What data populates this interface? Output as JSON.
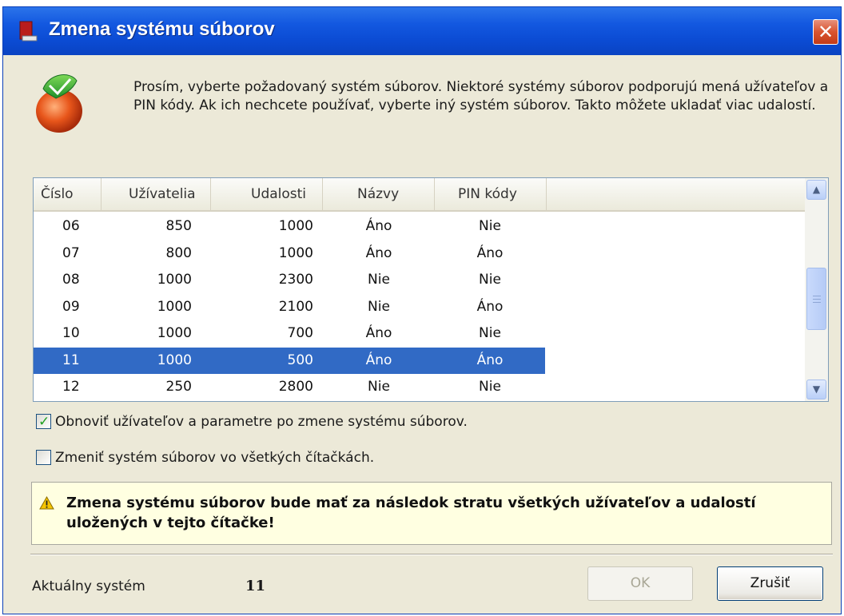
{
  "window": {
    "title": "Zmena systému súborov",
    "close_label": "✕"
  },
  "intro_text": "Prosím, vyberte požadovaný systém súborov. Niektoré systémy súborov podporujú mená užívateľov a PIN kódy. Ak ich nechcete používať, vyberte iný systém súborov. Takto môžete ukladať viac udalostí.",
  "table": {
    "columns": [
      "Číslo",
      "Užívatelia",
      "Udalosti",
      "Názvy",
      "PIN kódy"
    ],
    "rows": [
      [
        "06",
        "850",
        "1000",
        "Áno",
        "Nie"
      ],
      [
        "07",
        "800",
        "1000",
        "Áno",
        "Áno"
      ],
      [
        "08",
        "1000",
        "2300",
        "Nie",
        "Nie"
      ],
      [
        "09",
        "1000",
        "2100",
        "Nie",
        "Áno"
      ],
      [
        "10",
        "1000",
        "700",
        "Áno",
        "Nie"
      ],
      [
        "11",
        "1000",
        "500",
        "Áno",
        "Áno"
      ],
      [
        "12",
        "250",
        "2800",
        "Nie",
        "Nie"
      ]
    ],
    "selected_row_number": "11"
  },
  "options": {
    "restore_users": {
      "label": "Obnoviť užívateľov a parametre po zmene systému súborov.",
      "checked": true
    },
    "change_all_readers": {
      "label": "Zmeniť systém súborov vo všetkých čítačkách.",
      "checked": false
    }
  },
  "warning": {
    "icon": "warning-triangle-icon",
    "text": "Zmena systému súborov bude mať za následok stratu všetkých užívateľov a udalostí uložených v tejto čítačke!"
  },
  "footer": {
    "current_system_label": "Aktuálny systém",
    "current_system_value": "11",
    "ok_label": "OK",
    "ok_enabled": false,
    "cancel_label": "Zrušiť"
  },
  "colors": {
    "titlebar": "#0b4bd3",
    "selection": "#316ac5",
    "warning_bg": "#ffffe1",
    "dialog_bg": "#ece9d8"
  }
}
